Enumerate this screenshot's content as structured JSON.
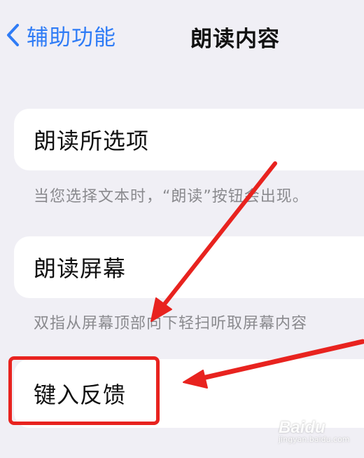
{
  "nav": {
    "back_label": "辅助功能",
    "title": "朗读内容"
  },
  "rows": [
    {
      "label": "朗读所选项",
      "footer": "当您选择文本时，“朗读”按钮会出现。"
    },
    {
      "label": "朗读屏幕",
      "footer": "双指从屏幕顶部向下轻扫听取屏幕内容"
    },
    {
      "label": "键入反馈"
    }
  ],
  "annotation": {
    "highlight_color": "#e8231f"
  },
  "watermark": {
    "logo": "Baidu",
    "sub": "jingyan.baidu.com"
  },
  "colors": {
    "accent": "#2f7cf6",
    "background": "#f0eff5",
    "footer_text": "#8a8a8e"
  }
}
